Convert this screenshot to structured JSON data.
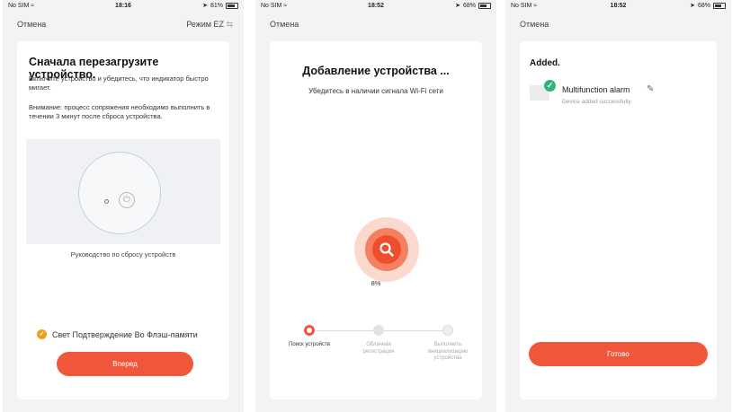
{
  "screens": [
    {
      "status": {
        "carrier": "No SIM",
        "time": "18:16",
        "battery": "81%",
        "battery_level": 0.81
      },
      "nav": {
        "cancel": "Отмена",
        "mode": "Режим EZ"
      },
      "title": "Сначала перезагрузите устройство.",
      "text1": "Включите устройство и убедитесь, что индикатор быстро мигает.",
      "text2": "Внимание: процесс сопряжения необходимо выполнить в течении 3 минут после сброса устройства.",
      "guide_link": "Руководство по сбросу устройств",
      "confirm_checkbox": {
        "label": "Свет Подтверждение Во Флэш-памяти",
        "checked": true
      },
      "next_button": "Вперед"
    },
    {
      "status": {
        "carrier": "No SIM",
        "time": "18:52",
        "battery": "68%",
        "battery_level": 0.68
      },
      "nav": {
        "cancel": "Отмена"
      },
      "title": "Добавление устройства ...",
      "subtitle": "Убедитесь в наличии сигнала Wi-Fi сети",
      "progress_label": "8%",
      "progress": 0.08,
      "steps": [
        {
          "label": "Поиск устройств",
          "active": true
        },
        {
          "label": "Облачная регистрация",
          "active": false
        },
        {
          "label": "Выполнить инициализацию устройства",
          "active": false
        }
      ]
    },
    {
      "status": {
        "carrier": "No SIM",
        "time": "18:52",
        "battery": "68%",
        "battery_level": 0.68
      },
      "nav": {
        "cancel": "Отмена"
      },
      "title": "Added.",
      "device": {
        "name": "Multifunction alarm",
        "status": "Device added successfully"
      },
      "done_button": "Готово"
    }
  ],
  "colors": {
    "accent": "#f0573a",
    "success": "#2fb57c",
    "checkbox": "#e9a21c",
    "background": "#f3f3f3"
  },
  "icons": [
    "wifi-icon",
    "location-icon",
    "battery-icon",
    "power-icon",
    "search-icon",
    "checkmark-icon",
    "pencil-icon"
  ]
}
